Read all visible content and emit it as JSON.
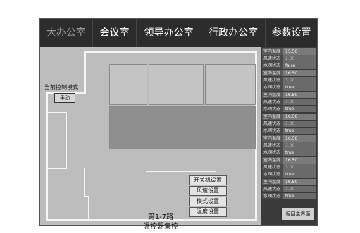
{
  "nav": {
    "tabs": [
      {
        "label": "大办公室",
        "active": true
      },
      {
        "label": "会议室",
        "active": false
      },
      {
        "label": "领导办公室",
        "active": false
      },
      {
        "label": "行政办公室",
        "active": false
      },
      {
        "label": "参数设置",
        "active": false
      }
    ]
  },
  "plan": {
    "mode_label": "当前控制模式",
    "mode_button": "手动",
    "center_label": "第1-7路\n温控器集控",
    "buttons": {
      "power": "开关机设置",
      "fan": "风速设置",
      "mode": "模式设置",
      "temp": "温度设置"
    }
  },
  "status_panel": {
    "groups": [
      {
        "temp_label": "室内温度",
        "temp_value": "15.50",
        "fan_label": "风速状态",
        "fan_value": "2.00",
        "valve_label": "水阀状态",
        "valve_value": "false"
      },
      {
        "temp_label": "室内温度",
        "temp_value": "16.50",
        "fan_label": "风速状态",
        "fan_value": "3.00",
        "valve_label": "水阀状态",
        "valve_value": "true"
      },
      {
        "temp_label": "室内温度",
        "temp_value": "16.50",
        "fan_label": "风速状态",
        "fan_value": "3.00",
        "valve_label": "水阀状态",
        "valve_value": "true"
      },
      {
        "temp_label": "室内温度",
        "temp_value": "16.50",
        "fan_label": "风速状态",
        "fan_value": "3.00",
        "valve_label": "水阀状态",
        "valve_value": "true"
      },
      {
        "temp_label": "室内温度",
        "temp_value": "16.50",
        "fan_label": "风速状态",
        "fan_value": "3.00",
        "valve_label": "水阀状态",
        "valve_value": "true"
      },
      {
        "temp_label": "室内温度",
        "temp_value": "16.50",
        "fan_label": "风速状态",
        "fan_value": "3.00",
        "valve_label": "水阀状态",
        "valve_value": "true"
      },
      {
        "temp_label": "室内温度",
        "temp_value": "16.50",
        "fan_label": "风速状态",
        "fan_value": "3.00",
        "valve_label": "水阀状态",
        "valve_value": "true"
      }
    ],
    "return_button": "返回主界面"
  }
}
